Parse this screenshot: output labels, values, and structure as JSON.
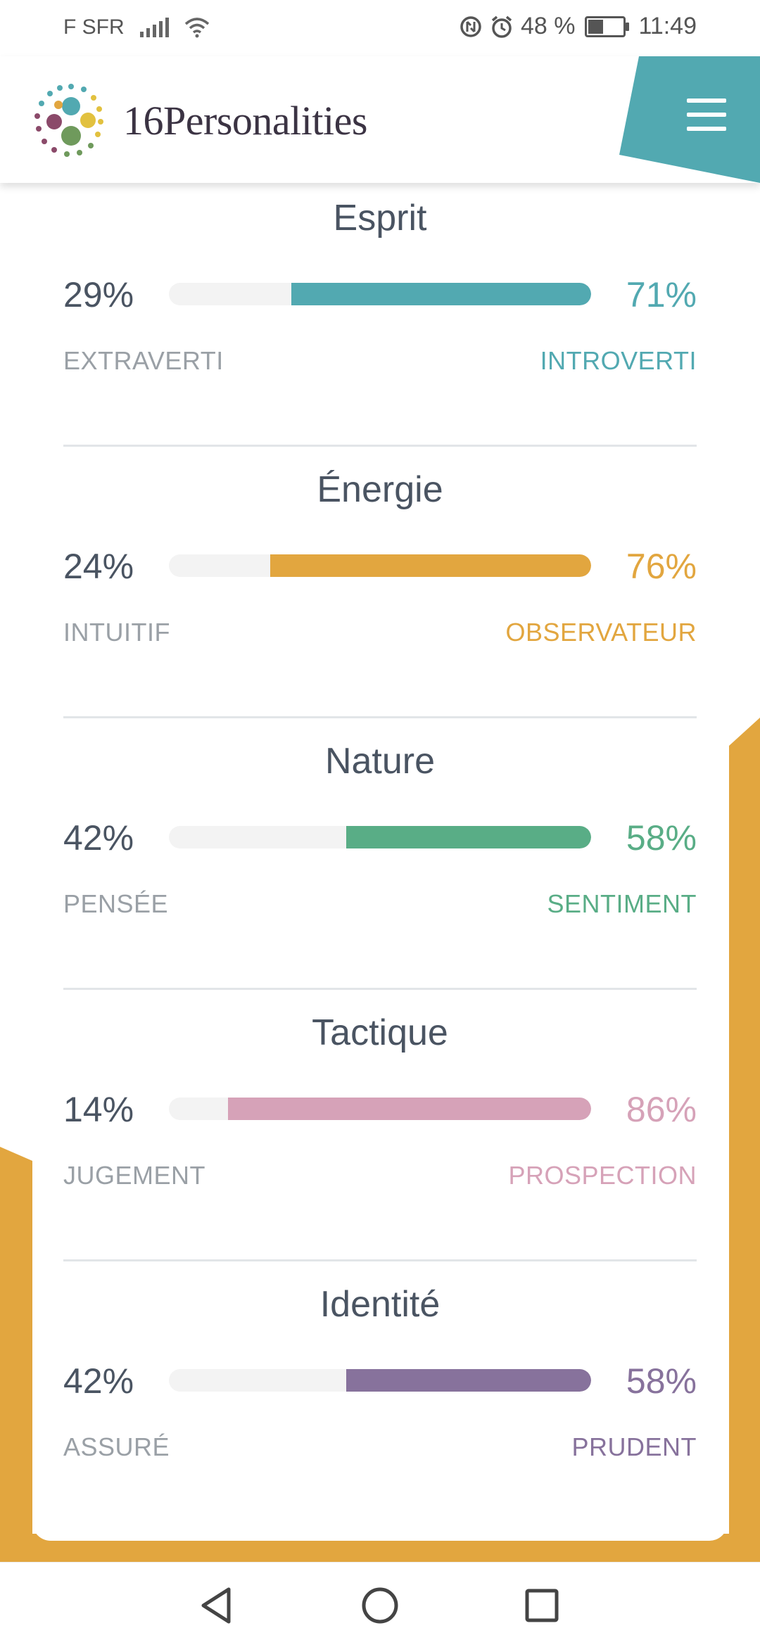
{
  "status_bar": {
    "carrier": "F SFR",
    "battery": "48 %",
    "time": "11:49"
  },
  "header": {
    "logo_text": "16Personalities"
  },
  "colors": {
    "teal": "#52a9b1",
    "yellow": "#e2a63f",
    "green": "#59ad86",
    "pink": "#d6a2b8",
    "purple": "#87729c",
    "text_dark": "#4a5462",
    "text_muted": "#9aa0a6"
  },
  "traits": [
    {
      "title": "Esprit",
      "left_pct": "29%",
      "right_pct": "71%",
      "left_label": "EXTRAVERTI",
      "right_label": "INTROVERTI",
      "fill": 0.71,
      "color": "#52a9b1"
    },
    {
      "title": "Énergie",
      "left_pct": "24%",
      "right_pct": "76%",
      "left_label": "INTUITIF",
      "right_label": "OBSERVATEUR",
      "fill": 0.76,
      "color": "#e2a63f"
    },
    {
      "title": "Nature",
      "left_pct": "42%",
      "right_pct": "58%",
      "left_label": "PENSÉE",
      "right_label": "SENTIMENT",
      "fill": 0.58,
      "color": "#59ad86"
    },
    {
      "title": "Tactique",
      "left_pct": "14%",
      "right_pct": "86%",
      "left_label": "JUGEMENT",
      "right_label": "PROSPECTION",
      "fill": 0.86,
      "color": "#d6a2b8"
    },
    {
      "title": "Identité",
      "left_pct": "42%",
      "right_pct": "58%",
      "left_label": "ASSURÉ",
      "right_label": "PRUDENT",
      "fill": 0.58,
      "color": "#87729c"
    }
  ],
  "nav_icons": [
    "back-triangle-icon",
    "home-circle-icon",
    "recents-square-icon"
  ]
}
